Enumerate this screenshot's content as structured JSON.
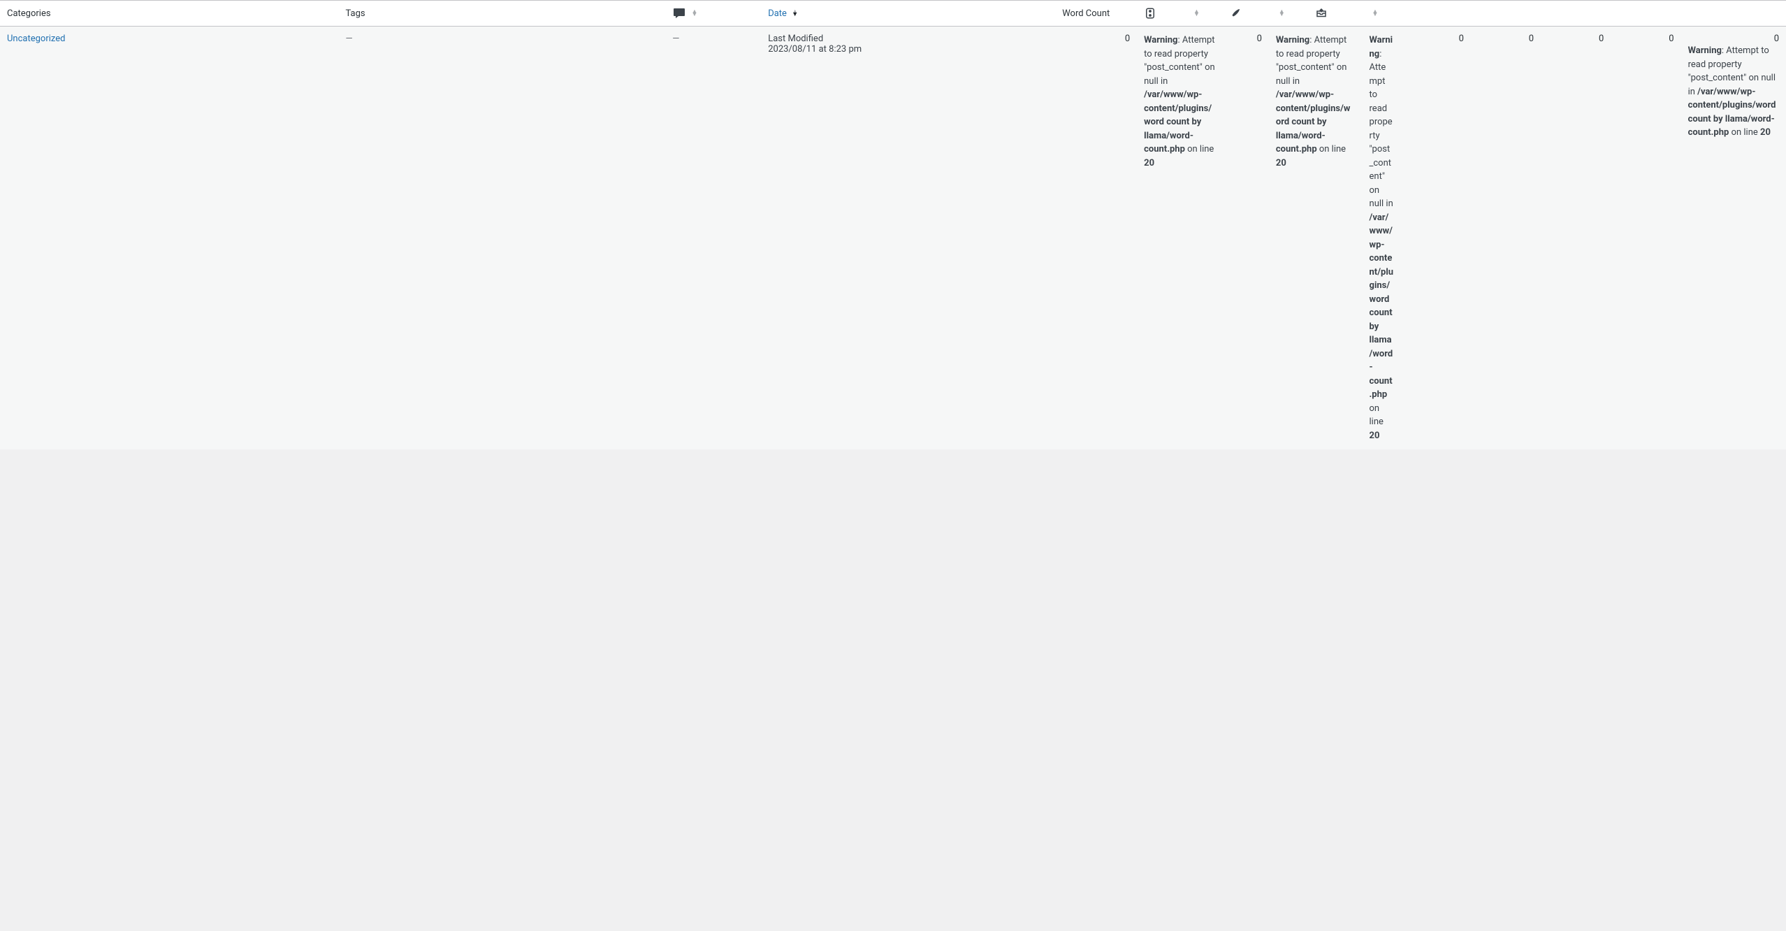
{
  "columns": {
    "categories": "Categories",
    "tags": "Tags",
    "date": "Date",
    "wordcount": "Word Count"
  },
  "row": {
    "category": "Uncategorized",
    "tags": "—",
    "comments": "—",
    "date_label": "Last Modified",
    "date_value": "2023/08/11 at 8:23 pm"
  },
  "warning": {
    "label": "Warning",
    "msg_part1": ": Attempt to read property \"post_content\" on null in ",
    "path": "/var/www/wp-content/plugins/word count by llama/word-count.php",
    "online": " on line ",
    "line": "20"
  },
  "zeros": {
    "z": "0"
  }
}
